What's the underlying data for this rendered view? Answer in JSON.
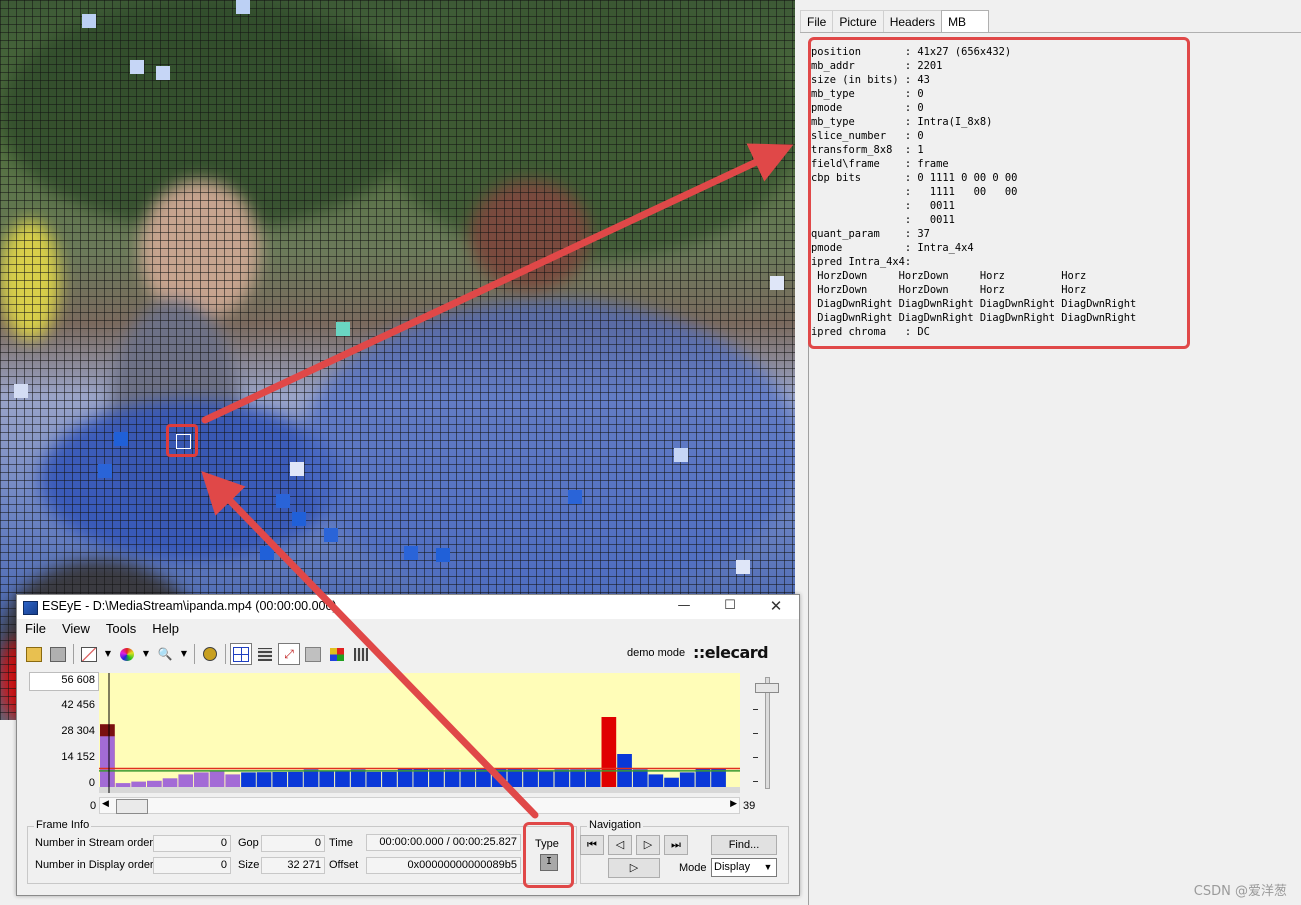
{
  "tabs": [
    "File",
    "Picture",
    "Headers",
    "MB"
  ],
  "active_tab": "MB",
  "mb_info": [
    "position       : 41x27 (656x432)",
    "mb_addr        : 2201",
    "size (in bits) : 43",
    "mb_type        : 0",
    "pmode          : 0",
    "mb_type        : Intra(I_8x8)",
    "slice_number   : 0",
    "transform_8x8  : 1",
    "field\\frame    : frame",
    "cbp bits       : 0 1111 0 00 0 00",
    "               :   1111   00   00",
    "               :   0011",
    "               :   0011",
    "quant_param    : 37",
    "pmode          : Intra_4x4",
    "ipred Intra_4x4:",
    " HorzDown     HorzDown     Horz         Horz",
    " HorzDown     HorzDown     Horz         Horz",
    " DiagDwnRight DiagDwnRight DiagDwnRight DiagDwnRight",
    " DiagDwnRight DiagDwnRight DiagDwnRight DiagDwnRight",
    "ipred chroma   : DC"
  ],
  "window": {
    "title": "ESEyE - D:\\MediaStream\\ipanda.mp4 (00:00:00.000)",
    "menus": [
      "File",
      "View",
      "Tools",
      "Help"
    ],
    "demo_mode": "demo mode",
    "logo": "::elecard"
  },
  "chart": {
    "y_ticks": [
      "56 608",
      "42 456",
      "28 304",
      "14 152",
      "0"
    ],
    "x_start": "0",
    "x_end": "39"
  },
  "chart_data": {
    "type": "bar",
    "title": "",
    "xlabel": "",
    "ylabel": "",
    "ylim": [
      0,
      56608
    ],
    "xlim": [
      0,
      39
    ],
    "series": [
      {
        "name": "",
        "values": [
          32271,
          2000,
          2800,
          3200,
          4500,
          6500,
          7500,
          8000,
          6500,
          7500,
          7600,
          7700,
          7800,
          9000,
          8300,
          8300,
          9000,
          7800,
          7800,
          9500,
          9300,
          9000,
          9000,
          9000,
          9200,
          9200,
          9200,
          9000,
          8500,
          9000,
          9000,
          9000,
          36000,
          17000,
          9000,
          6500,
          4800,
          7500,
          9500,
          9500
        ]
      }
    ],
    "frame_colors": [
      "#c03030",
      "#a36bd6",
      "#a36bd6",
      "#a36bd6",
      "#a36bd6",
      "#a36bd6",
      "#a36bd6",
      "#a36bd6",
      "#a36bd6",
      "#0a38d8",
      "#0a38d8",
      "#0a38d8",
      "#0a38d8",
      "#0a38d8",
      "#0a38d8",
      "#0a38d8",
      "#0a38d8",
      "#0a38d8",
      "#0a38d8",
      "#0a38d8",
      "#0a38d8",
      "#0a38d8",
      "#0a38d8",
      "#0a38d8",
      "#0a38d8",
      "#0a38d8",
      "#0a38d8",
      "#0a38d8",
      "#0a38d8",
      "#0a38d8",
      "#0a38d8",
      "#0a38d8",
      "#e00000",
      "#0a38d8",
      "#0a38d8",
      "#0a38d8",
      "#0a38d8",
      "#0a38d8",
      "#0a38d8",
      "#0a38d8"
    ],
    "reference_lines": [
      {
        "value": 9500,
        "color": "#e03020"
      },
      {
        "value": 8300,
        "color": "#3a9a30"
      }
    ]
  },
  "frame_info": {
    "group_label": "Frame Info",
    "stream_order_label": "Number in Stream order",
    "stream_order_value": "0",
    "display_order_label": "Number in Display order",
    "display_order_value": "0",
    "gop_label": "Gop",
    "gop_value": "0",
    "size_label": "Size",
    "size_value": "32 271",
    "time_label": "Time",
    "time_value": "00:00:00.000 / 00:00:25.827",
    "offset_label": "Offset",
    "offset_value": "0x00000000000089b5",
    "type_label": "Type",
    "type_value": "I"
  },
  "navigation": {
    "group_label": "Navigation",
    "find_label": "Find...",
    "mode_label": "Mode",
    "mode_value": "Display"
  },
  "watermark": "CSDN @爱洋葱",
  "colors": {
    "annotation": "#e04848",
    "plot_background": "#fffdb8"
  }
}
